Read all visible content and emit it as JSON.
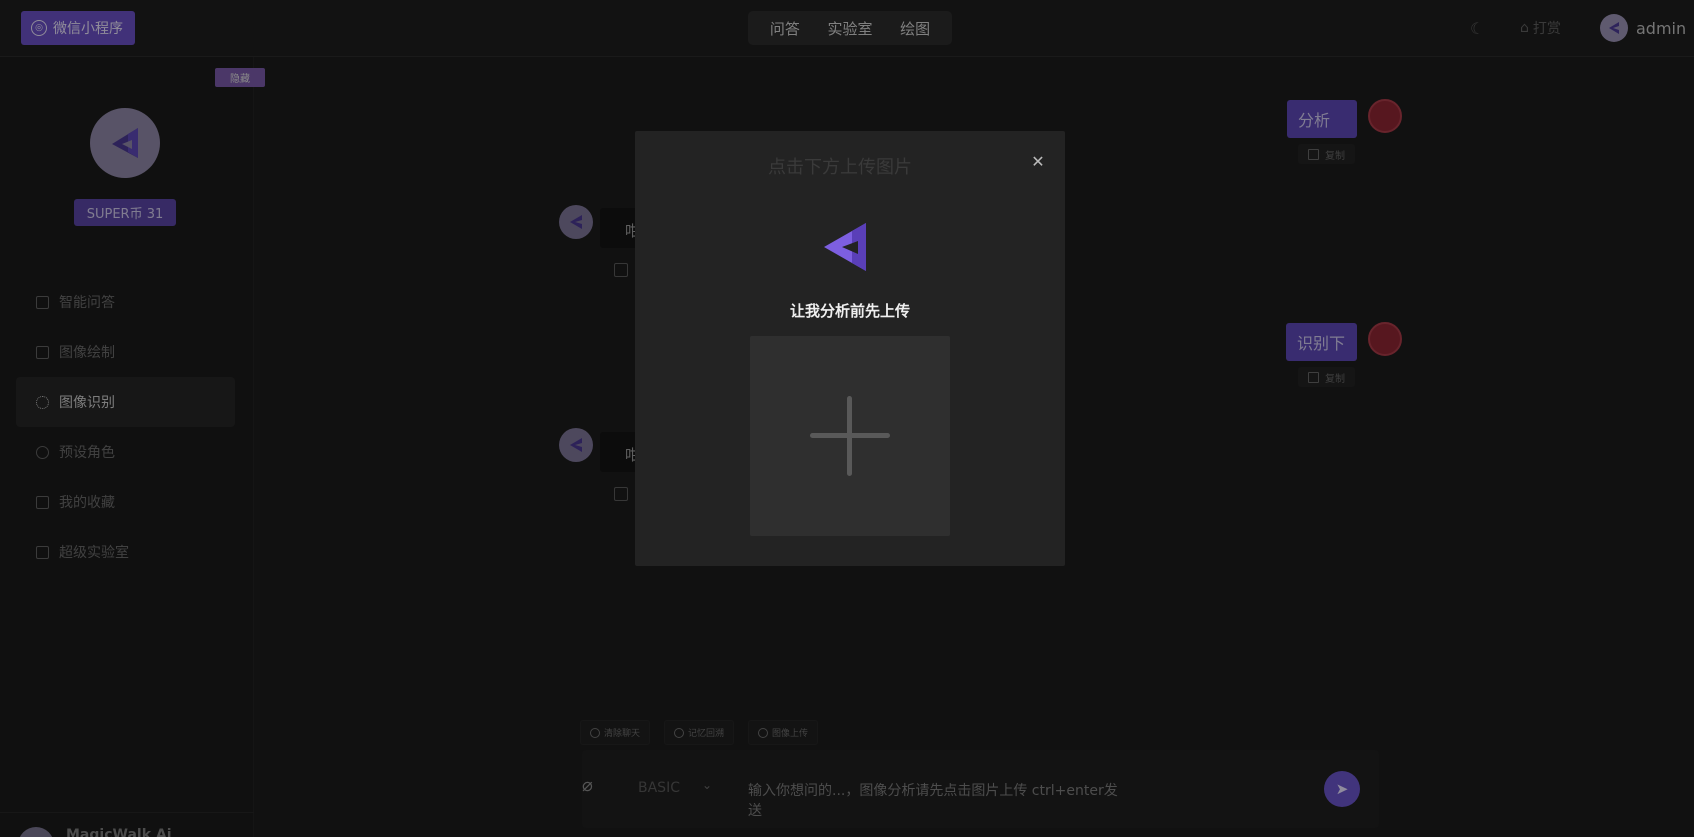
{
  "header": {
    "wechat_label": "微信小程序",
    "tabs": [
      "问答",
      "实验室",
      "绘图"
    ],
    "reward_label": "打赏",
    "username": "admin"
  },
  "sidebar": {
    "hide_label": "隐藏",
    "coins_label": "SUPER币 31",
    "items": [
      {
        "label": "智能问答"
      },
      {
        "label": "图像绘制"
      },
      {
        "label": "图像识别"
      },
      {
        "label": "预设角色"
      },
      {
        "label": "我的收藏"
      },
      {
        "label": "超级实验室"
      }
    ],
    "footer_name": "MagicWalk Ai"
  },
  "chat": {
    "messages": [
      {
        "role": "user",
        "text": "分析",
        "copy_label": "复制"
      },
      {
        "role": "bot",
        "text": "咁"
      },
      {
        "role": "user",
        "text": "识别下",
        "copy_label": "复制"
      },
      {
        "role": "bot",
        "text": "咁"
      }
    ]
  },
  "input": {
    "quick_actions": [
      "清除聊天",
      "记忆回溯",
      "图像上传"
    ],
    "model": "BASIC",
    "placeholder": "输入你想问的...，图像分析请先点击图片上传  ctrl+enter发送"
  },
  "modal": {
    "title": "点击下方上传图片",
    "subtitle": "让我分析前先上传"
  },
  "colors": {
    "accent": "#6a55c9",
    "background": "#1c1c1c",
    "badge": "#7a5aa8"
  }
}
